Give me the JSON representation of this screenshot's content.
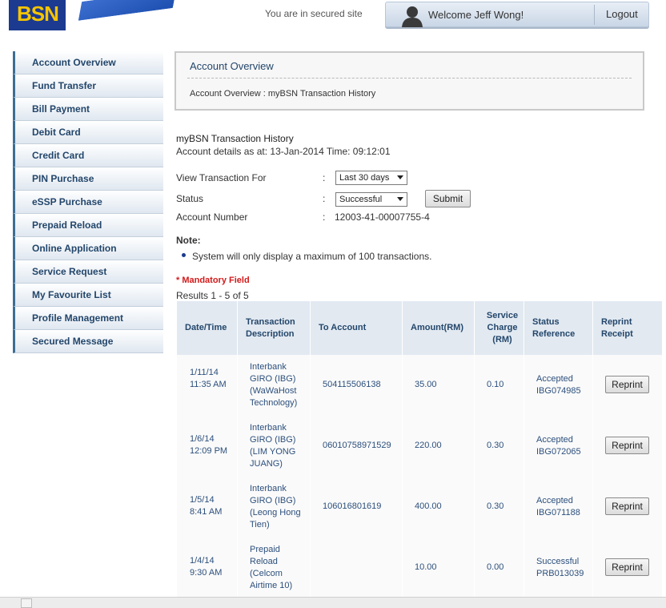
{
  "header": {
    "logo_text": "BSN",
    "secured_text": "You are in secured site",
    "welcome_text": "Welcome Jeff Wong!",
    "logout_label": "Logout"
  },
  "sidebar": {
    "items": [
      {
        "label": "Account Overview"
      },
      {
        "label": "Fund Transfer"
      },
      {
        "label": "Bill Payment"
      },
      {
        "label": "Debit Card"
      },
      {
        "label": "Credit Card"
      },
      {
        "label": "PIN Purchase"
      },
      {
        "label": "eSSP Purchase"
      },
      {
        "label": "Prepaid Reload"
      },
      {
        "label": "Online Application"
      },
      {
        "label": "Service Request"
      },
      {
        "label": "My Favourite List"
      },
      {
        "label": "Profile Management"
      },
      {
        "label": "Secured Message"
      }
    ]
  },
  "breadcrumb": {
    "title": "Account Overview",
    "path": "Account Overview : myBSN Transaction History"
  },
  "main": {
    "page_title": "myBSN Transaction History",
    "account_details": "Account details as at: 13-Jan-2014 Time: 09:12:01",
    "form": {
      "view_label": "View Transaction For",
      "view_value": "Last 30 days",
      "status_label": "Status",
      "status_value": "Successful",
      "account_label": "Account Number",
      "account_value": "12003-41-00007755-4",
      "colon": ":",
      "submit_label": "Submit"
    },
    "note_label": "Note:",
    "note_text": "System will only display a maximum of 100 transactions.",
    "mandatory_text": "* Mandatory Field",
    "results_text": "Results 1 - 5 of 5"
  },
  "table": {
    "headers": [
      "Date/Time",
      "Transaction Description",
      "To Account",
      "Amount(RM)",
      "Service Charge (RM)",
      "Status Reference",
      "Reprint Receipt"
    ],
    "rows": [
      {
        "date": "1/11/14 11:35 AM",
        "desc": "Interbank GIRO (IBG) (WaWaHost Technology)",
        "to_account": "504115506138",
        "amount": "35.00",
        "charge": "0.10",
        "status": "Accepted IBG074985",
        "reprint": "Reprint"
      },
      {
        "date": "1/6/14 12:09 PM",
        "desc": "Interbank GIRO (IBG) (LIM YONG JUANG)",
        "to_account": "06010758971529",
        "amount": "220.00",
        "charge": "0.30",
        "status": "Accepted IBG072065",
        "reprint": "Reprint"
      },
      {
        "date": "1/5/14 8:41 AM",
        "desc": "Interbank GIRO (IBG) (Leong Hong Tien)",
        "to_account": "106016801619",
        "amount": "400.00",
        "charge": "0.30",
        "status": "Accepted IBG071188",
        "reprint": "Reprint"
      },
      {
        "date": "1/4/14 9:30 AM",
        "desc": "Prepaid Reload (Celcom Airtime 10)",
        "to_account": "",
        "amount": "10.00",
        "charge": "0.00",
        "status": "Successful PRB013039",
        "reprint": "Reprint"
      }
    ]
  },
  "colors": {
    "brand_blue": "#1c3a8f",
    "logo_yellow": "#f5c400",
    "nav_text": "#23466b",
    "mandatory_red": "#d21a1a",
    "table_header_bg": "#e2e9f1"
  },
  "icons": {
    "user": "user-silhouette-icon",
    "bullet": "bullet-icon",
    "dropdown": "chevron-down-icon"
  }
}
